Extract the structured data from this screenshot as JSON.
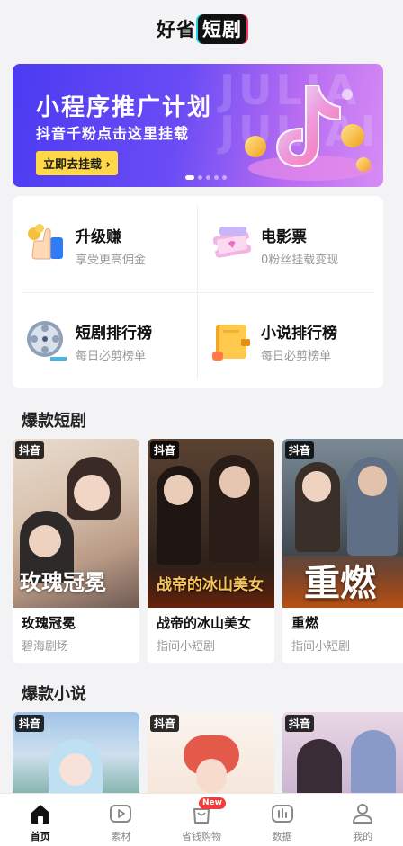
{
  "header": {
    "logo_prefix": "好省",
    "logo_box": "短剧"
  },
  "banner": {
    "title": "小程序推广计划",
    "subtitle": "抖音千粉点击这里挂载",
    "button": "立即去挂载 ›",
    "bg_text_1": "JULIA",
    "bg_text_2": "JULIAI",
    "dots_total": 5,
    "dots_active": 1
  },
  "features": [
    {
      "title": "升级赚",
      "subtitle": "享受更高佣金",
      "icon": "thumbs-up-coins-icon"
    },
    {
      "title": "电影票",
      "subtitle": "0粉丝挂载变现",
      "icon": "movie-ticket-icon"
    },
    {
      "title": "短剧排行榜",
      "subtitle": "每日必剪榜单",
      "icon": "film-reel-icon"
    },
    {
      "title": "小说排行榜",
      "subtitle": "每日必剪榜单",
      "icon": "book-icon"
    }
  ],
  "sections": {
    "dramas": "爆款短剧",
    "novels": "爆款小说"
  },
  "dramas": [
    {
      "tag": "抖音",
      "title": "玫瑰冠冕",
      "source": "碧海剧场",
      "poster_text": "玫瑰冠冕"
    },
    {
      "tag": "抖音",
      "title": "战帝的冰山美女",
      "source": "指间小短剧",
      "poster_text": "战帝的冰山美女"
    },
    {
      "tag": "抖音",
      "title": "重燃",
      "source": "指间小短剧",
      "poster_text": "重燃"
    }
  ],
  "novels": [
    {
      "tag": "抖音"
    },
    {
      "tag": "抖音"
    },
    {
      "tag": "抖音"
    }
  ],
  "tabbar": [
    {
      "label": "首页",
      "icon": "home-icon",
      "active": true
    },
    {
      "label": "素材",
      "icon": "play-box-icon"
    },
    {
      "label": "省钱购物",
      "icon": "shopping-bag-icon",
      "badge": "New"
    },
    {
      "label": "数据",
      "icon": "bar-chart-icon"
    },
    {
      "label": "我的",
      "icon": "user-icon"
    }
  ],
  "colors": {
    "accent_banner": "#4b3bf2",
    "button_yellow": "#ffd84a",
    "badge_red": "#f23b3b"
  }
}
